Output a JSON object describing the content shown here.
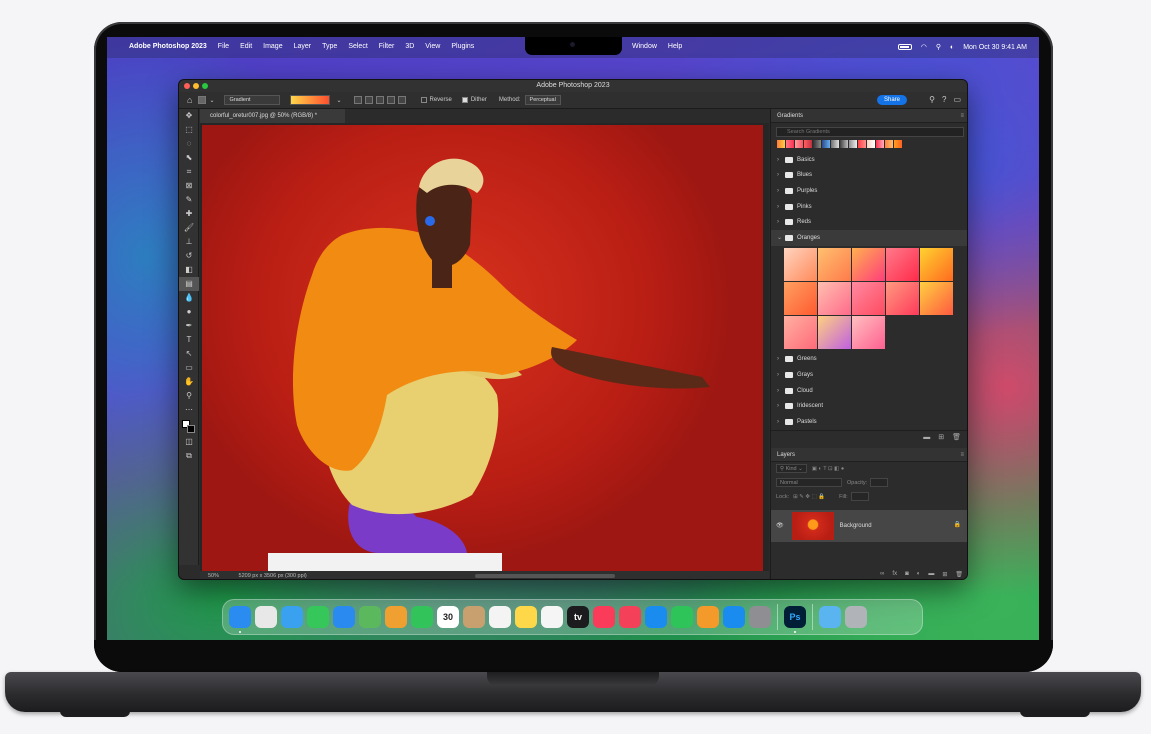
{
  "menubar": {
    "app_name": "Adobe Photoshop 2023",
    "menus": [
      "File",
      "Edit",
      "Image",
      "Layer",
      "Type",
      "Select",
      "Filter",
      "3D",
      "View",
      "Plugins"
    ],
    "menus_right": [
      "Window",
      "Help"
    ],
    "datetime": "Mon Oct 30 9:41 AM"
  },
  "window": {
    "title": "Adobe Photoshop 2023",
    "tool_dropdown": "Gradient",
    "reverse_label": "Reverse",
    "dither_label": "Dither",
    "method_label": "Method:",
    "method_value": "Perceptual",
    "share_label": "Share"
  },
  "document": {
    "tab_label": "colorful_oretur007.jpg @ 50% (RGB/8) *",
    "zoom": "50%",
    "info": "5209 px x 3506 px (300 ppi)"
  },
  "gradients_panel": {
    "title": "Gradients",
    "search_placeholder": "Search Gradients",
    "folders_before": [
      "Basics",
      "Blues",
      "Purples",
      "Pinks",
      "Reds"
    ],
    "open_folder": "Oranges",
    "folders_after": [
      "Greens",
      "Grays",
      "Cloud",
      "Iridescent",
      "Pastels"
    ],
    "swatches": [
      [
        "#ffd4c0",
        "#ff8a5a"
      ],
      [
        "#ffc070",
        "#ff7a4a"
      ],
      [
        "#ffb050",
        "#ff3d7a"
      ],
      [
        "#ff7a8a",
        "#ff2a4a"
      ],
      [
        "#ffd230",
        "#ff6a20"
      ],
      [
        "#ffa060",
        "#ff5a30"
      ],
      [
        "#ffc0b0",
        "#ff6a8a"
      ],
      [
        "#ff8aa0",
        "#ff4a60"
      ],
      [
        "#ff9a80",
        "#ff3a5a"
      ],
      [
        "#ffd040",
        "#ff5a40"
      ],
      [
        "#ffb0a0",
        "#ff6a7a"
      ],
      [
        "#ffd080",
        "#c060e0"
      ],
      [
        "#ffc0c0",
        "#ff6090"
      ]
    ],
    "colors": {
      "accent": "#1473e6",
      "panel": "#2c2c2c"
    }
  },
  "layers_panel": {
    "title": "Layers",
    "kind_label": "Kind",
    "blend_mode": "Normal",
    "opacity_label": "Opacity:",
    "lock_label": "Lock:",
    "fill_label": "Fill:",
    "layer_name": "Background"
  },
  "dock": {
    "apps": [
      {
        "icon": "finder-icon",
        "color": "#2a8cf0"
      },
      {
        "icon": "launchpad-icon",
        "color": "#e8e8e8"
      },
      {
        "icon": "safari-icon",
        "color": "#3aa0f0"
      },
      {
        "icon": "messages-icon",
        "color": "#35c759"
      },
      {
        "icon": "mail-icon",
        "color": "#2b8af0"
      },
      {
        "icon": "maps-icon",
        "color": "#5cb85c"
      },
      {
        "icon": "photos-icon",
        "color": "#f0a030"
      },
      {
        "icon": "facetime-icon",
        "color": "#32c35a"
      },
      {
        "icon": "calendar-icon",
        "color": "#ffffff",
        "text": "30"
      },
      {
        "icon": "contacts-icon",
        "color": "#c8a070"
      },
      {
        "icon": "reminders-icon",
        "color": "#f4f4f4"
      },
      {
        "icon": "notes-icon",
        "color": "#ffd84a"
      },
      {
        "icon": "freeform-icon",
        "color": "#f5f5f5"
      },
      {
        "icon": "tv-icon",
        "color": "#1c1c1e",
        "text": "tv"
      },
      {
        "icon": "music-icon",
        "color": "#fa3c5a"
      },
      {
        "icon": "news-icon",
        "color": "#f5405a"
      },
      {
        "icon": "keynote-icon",
        "color": "#1a8cf0"
      },
      {
        "icon": "numbers-icon",
        "color": "#2ec45a"
      },
      {
        "icon": "pages-icon",
        "color": "#f39a2a"
      },
      {
        "icon": "app-store-icon",
        "color": "#1a8cf0"
      },
      {
        "icon": "system-settings-icon",
        "color": "#8e8e93"
      },
      {
        "icon": "photoshop-icon",
        "color": "#001e36",
        "text": "Ps"
      }
    ],
    "extras": [
      {
        "icon": "downloads-folder-icon",
        "color": "#5ab4f0"
      },
      {
        "icon": "trash-icon",
        "color": "#b0b4b8"
      }
    ]
  }
}
